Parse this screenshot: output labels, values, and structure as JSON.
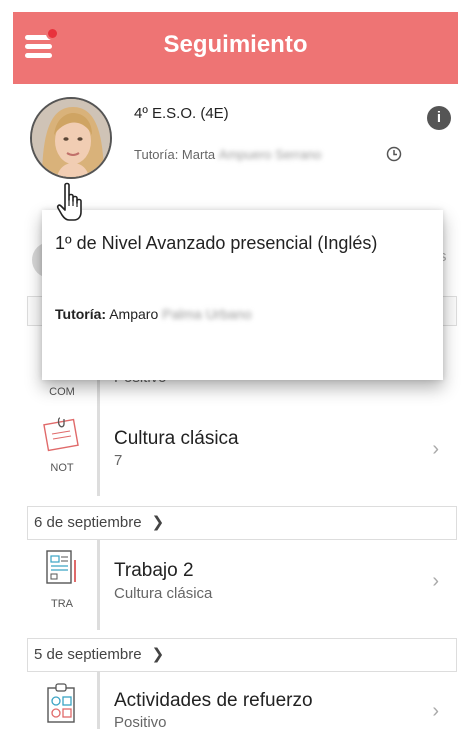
{
  "header": {
    "title": "Seguimiento",
    "menu_icon": "hamburger-menu-icon",
    "notification_color": "#e8323c",
    "bar_color": "#ee7474"
  },
  "profile": {
    "course": "4º E.S.O. (4E)",
    "tutor_label": "Tutoría: Marta",
    "tutor_surname": "Ampuero Serrano"
  },
  "popover": {
    "course_name": "1º de Nivel Avanzado presencial (Inglés)",
    "tutor_label": "Tutoría:",
    "tutor_name": "Amparo",
    "tutor_surname": "Palma Urbano"
  },
  "background": {
    "partial_text": "s"
  },
  "items": [
    {
      "code": "COM",
      "title": "Positivo"
    },
    {
      "code": "NOT",
      "title": "Cultura clásica",
      "subtitle": "7"
    },
    {
      "date": "6 de septiembre",
      "code": "TRA",
      "title": "Trabajo 2",
      "subtitle": "Cultura clásica"
    },
    {
      "date": "5 de septiembre",
      "code": "",
      "title": "Actividades de refuerzo",
      "subtitle": "Positivo"
    }
  ]
}
